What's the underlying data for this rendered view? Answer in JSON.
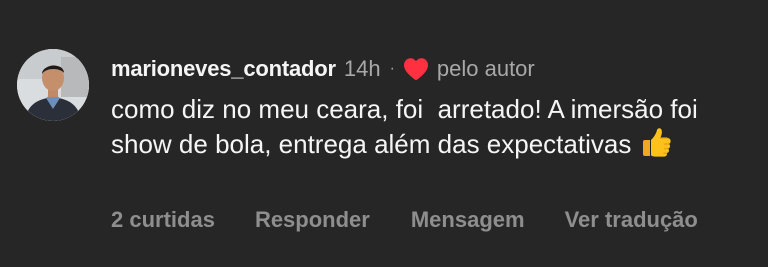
{
  "comment": {
    "username": "marioneves_contador",
    "time": "14h",
    "separator": "·",
    "author_liked_label": "pelo autor",
    "text": "como diz no meu ceara, foi  arretado! A imersão foi show de bola, entrega além das expectativas ",
    "icons": {
      "avatar": "profile-photo",
      "liked_by_author": "heart-icon",
      "emoji": "thumbs-up-icon"
    },
    "colors": {
      "background": "#262626",
      "primary_text": "#f5f5f5",
      "secondary_text": "#a8a8a8",
      "heart": "#ff3040"
    },
    "actions": {
      "likes": "2 curtidas",
      "reply": "Responder",
      "message": "Mensagem",
      "translate": "Ver tradução"
    }
  }
}
